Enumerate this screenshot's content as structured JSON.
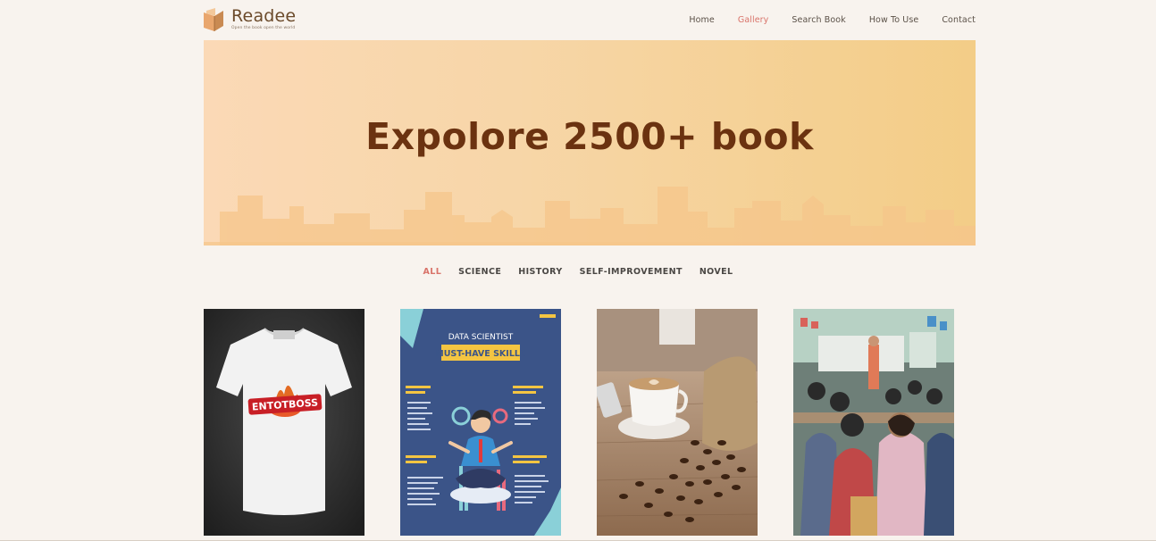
{
  "brand": {
    "name": "Readee",
    "tagline": "Open the book open the world"
  },
  "nav": {
    "items": [
      {
        "label": "Home",
        "active": false
      },
      {
        "label": "Gallery",
        "active": true
      },
      {
        "label": "Search Book",
        "active": false
      },
      {
        "label": "How To Use",
        "active": false
      },
      {
        "label": "Contact",
        "active": false
      }
    ]
  },
  "hero": {
    "title": "Expolore 2500+ book"
  },
  "filters": {
    "items": [
      {
        "label": "ALL",
        "active": true
      },
      {
        "label": "SCIENCE",
        "active": false
      },
      {
        "label": "HISTORY",
        "active": false
      },
      {
        "label": "SELF-IMPROVEMENT",
        "active": false
      },
      {
        "label": "NOVEL",
        "active": false
      }
    ]
  },
  "gallery": {
    "items": [
      {
        "image": "t-shirt-photo",
        "print_text": "ENTOTBOSS"
      },
      {
        "image": "data-scientist-poster",
        "poster_title": "DATA SCIENTIST",
        "poster_subtitle": "MUST-HAVE SKILLS"
      },
      {
        "image": "coffee-cup-and-beans-photo"
      },
      {
        "image": "classroom-photo"
      }
    ]
  },
  "colors": {
    "background": "#f8f3ee",
    "accent": "#d9736a",
    "hero_title": "#6b3210",
    "hero_gradient_start": "#fbd9b6",
    "hero_gradient_end": "#f3cd87"
  }
}
